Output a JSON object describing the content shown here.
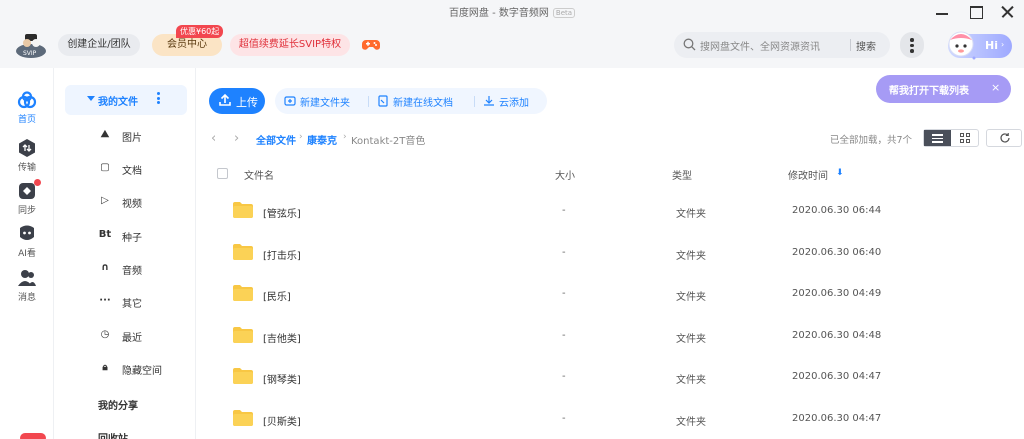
{
  "window": {
    "title": "百度网盘 - 数字音频网",
    "beta": "Beta"
  },
  "header": {
    "enterprise_label": "创建企业/团队",
    "member_label": "会员中心",
    "promo_tag": "优惠¥60起",
    "svip_label": "超值续费延长SVIP特权",
    "search_placeholder": "搜网盘文件、全网资源资讯",
    "search_button": "搜索",
    "hi_label": "Hi",
    "hi_chevron": "›"
  },
  "rail": {
    "items": [
      {
        "label": "首页",
        "icon": "home-icon"
      },
      {
        "label": "传输",
        "icon": "transfer-icon"
      },
      {
        "label": "同步",
        "icon": "sync-icon"
      },
      {
        "label": "AI看",
        "icon": "ai-icon"
      },
      {
        "label": "消息",
        "icon": "message-icon"
      }
    ]
  },
  "sidebar": {
    "my_files": "我的文件",
    "items": [
      {
        "label": "图片",
        "icon": "image-icon",
        "glyph": "⛰"
      },
      {
        "label": "文档",
        "icon": "document-icon",
        "glyph": "▢"
      },
      {
        "label": "视频",
        "icon": "video-icon",
        "glyph": "▷"
      },
      {
        "label": "种子",
        "icon": "torrent-icon",
        "glyph": "Bt"
      },
      {
        "label": "音频",
        "icon": "audio-icon",
        "glyph": "∩"
      },
      {
        "label": "其它",
        "icon": "other-icon",
        "glyph": "···"
      },
      {
        "label": "最近",
        "icon": "recent-icon",
        "glyph": "◷"
      },
      {
        "label": "隐藏空间",
        "icon": "lock-icon",
        "glyph": "🔒︎"
      }
    ],
    "my_share": "我的分享",
    "recycle_bin": "回收站"
  },
  "toolbar": {
    "upload": "上传",
    "new_folder": "新建文件夹",
    "new_online_doc": "新建在线文档",
    "cloud_add": "云添加"
  },
  "download_tip": {
    "label": "帮我打开下载列表",
    "close": "×"
  },
  "breadcrumb": {
    "back": "‹",
    "forward": "›",
    "sep": "›",
    "items": [
      "全部文件",
      "康泰克",
      "Kontakt-2T音色"
    ]
  },
  "status": {
    "loaded_text": "已全部加载，共7个"
  },
  "table": {
    "columns": {
      "name": "文件名",
      "size": "大小",
      "type": "类型",
      "modified": "修改时间"
    },
    "sort_indicator": "⬇",
    "rows": [
      {
        "name": "[管弦乐]",
        "size": "-",
        "type": "文件夹",
        "modified": "2020.06.30 06:44"
      },
      {
        "name": "[打击乐]",
        "size": "-",
        "type": "文件夹",
        "modified": "2020.06.30 06:40"
      },
      {
        "name": "[民乐]",
        "size": "-",
        "type": "文件夹",
        "modified": "2020.06.30 04:49"
      },
      {
        "name": "[吉他类]",
        "size": "-",
        "type": "文件夹",
        "modified": "2020.06.30 04:48"
      },
      {
        "name": "[钢琴类]",
        "size": "-",
        "type": "文件夹",
        "modified": "2020.06.30 04:47"
      },
      {
        "name": "[贝斯类]",
        "size": "-",
        "type": "文件夹",
        "modified": "2020.06.30 04:47"
      }
    ]
  },
  "colors": {
    "accent": "#1e82ff",
    "folder": "#f8c744",
    "svip_red": "#e0303a",
    "download_pill": "#a69bf5"
  }
}
